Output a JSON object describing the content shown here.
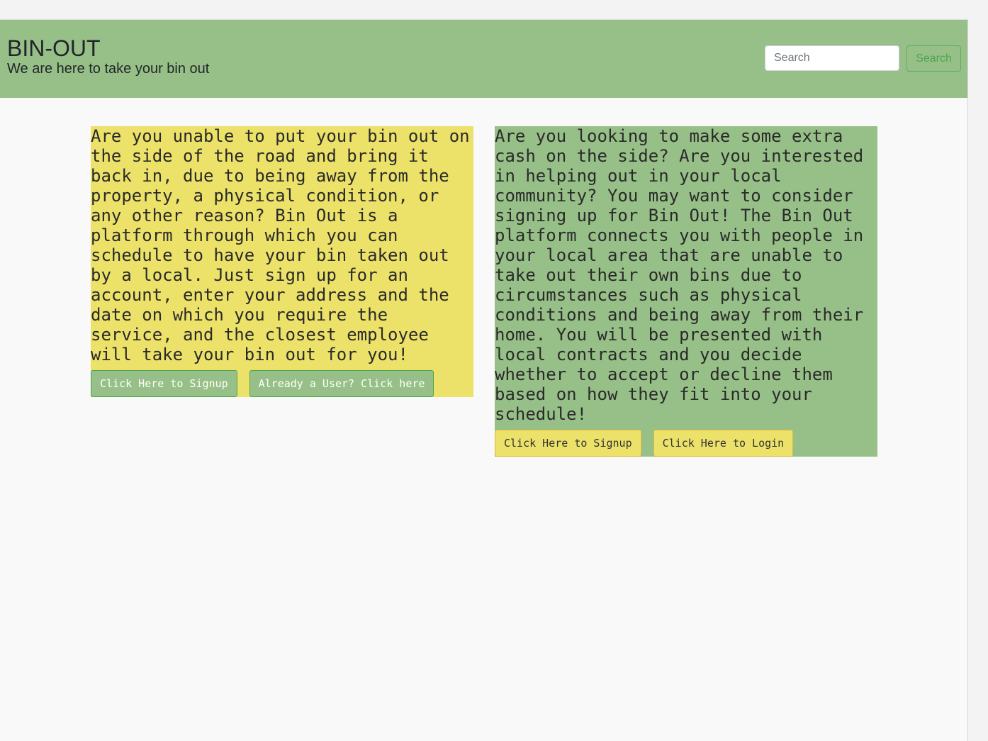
{
  "header": {
    "title": "BIN-OUT",
    "tagline": "We are here to take your bin out",
    "search_placeholder": "Search",
    "search_button": "Search"
  },
  "customer": {
    "text": "Are you unable to put your bin out on the side of the road and bring it back in, due to being away from the property, a physical condition, or any other reason? Bin Out is a platform through which you can schedule to have your bin taken out by a local. Just sign up for an account, enter your address and the date on which you require the service, and the closest employee will take your bin out for you!",
    "signup_button": "Click Here to Signup",
    "login_button": "Already a User? Click here"
  },
  "worker": {
    "text": "Are you looking to make some extra cash on the side? Are you interested in helping out in your local community? You may want to consider signing up for Bin Out! The Bin Out platform connects you with people in your local area that are unable to take out their own bins due to circumstances such as physical conditions and being away from their home. You will be presented with local contracts and you decide whether to accept or decline them based on how they fit into your schedule!",
    "signup_button": "Click Here to Signup",
    "login_button": "Click Here to Login"
  }
}
